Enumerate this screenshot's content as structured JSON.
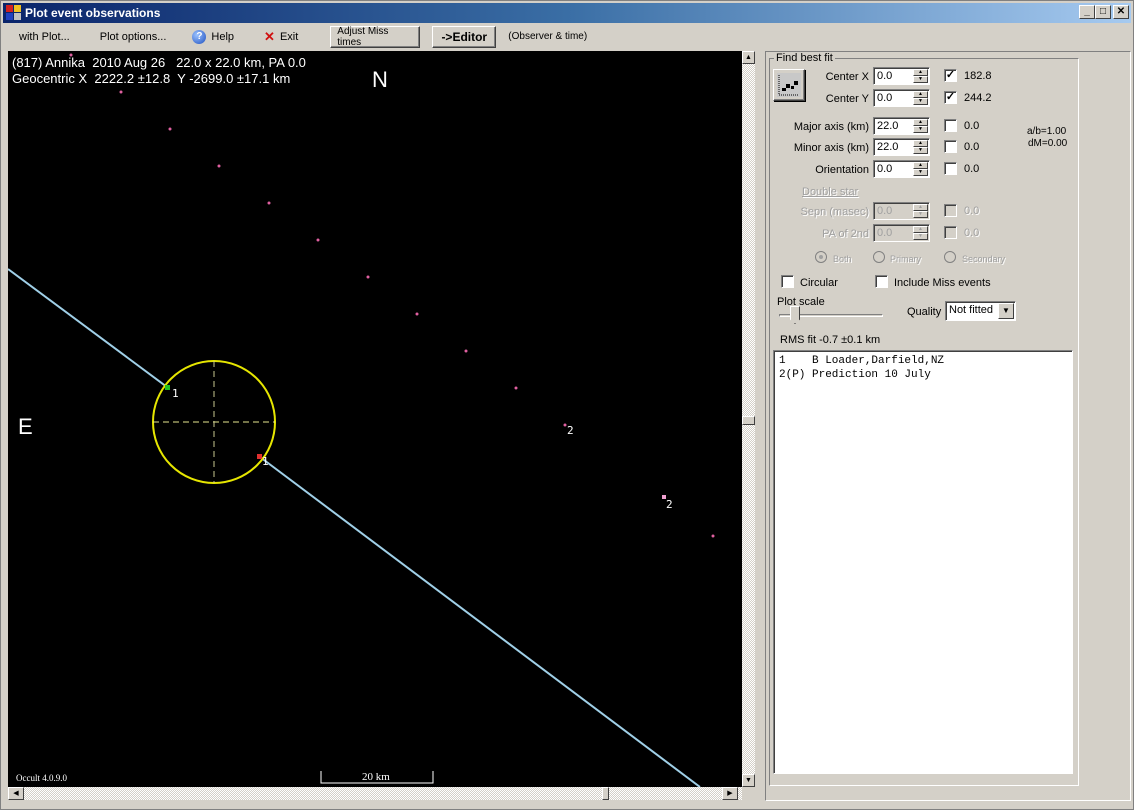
{
  "window": {
    "title": "Plot event observations",
    "controls": {
      "minimize": "_",
      "maximize": "□",
      "close": "✕"
    }
  },
  "menu": {
    "with_plot": "with Plot...",
    "plot_options": "Plot options...",
    "help": "Help",
    "exit": "Exit",
    "adjust_miss_times": "Adjust Miss times",
    "editor": "->Editor",
    "observer_time": "(Observer & time)"
  },
  "plot": {
    "header_line1": "(817) Annika  2010 Aug 26   22.0 x 22.0 km, PA 0.0",
    "header_line2": "Geocentric X  2222.2 ±12.8  Y -2699.0 ±17.1 km",
    "north_label": "N",
    "east_label": "E",
    "version": "Occult 4.0.9.0",
    "scale_bar_label": "20 km",
    "colors": {
      "background": "#000000",
      "ellipse": "#e6e600",
      "chord": "#a0d0e8",
      "disappear": "#20c020",
      "reappear": "#e03030",
      "prediction": "#e060a0"
    },
    "chord_labels": [
      "1",
      "1",
      "2",
      "2"
    ]
  },
  "fit_panel": {
    "group_label": "Find best fit",
    "center_x": {
      "label": "Center X",
      "value": "0.0",
      "checked": true,
      "result": "182.8"
    },
    "center_y": {
      "label": "Center Y",
      "value": "0.0",
      "checked": true,
      "result": "244.2"
    },
    "major_axis": {
      "label": "Major axis (km)",
      "value": "22.0",
      "checked": false,
      "result": "0.0"
    },
    "minor_axis": {
      "label": "Minor axis (km)",
      "value": "22.0",
      "checked": false,
      "result": "0.0"
    },
    "orientation": {
      "label": "Orientation",
      "value": "0.0",
      "checked": false,
      "result": "0.0"
    },
    "ratio_ab": "a/b=1.00",
    "dm": "dM=0.00",
    "double_star_label": "Double star",
    "sepn": {
      "label": "Sepn (masec)",
      "value": "0.0",
      "checked": false,
      "result": "0.0"
    },
    "pa_2nd": {
      "label": "PA of 2nd",
      "value": "0.0",
      "checked": false,
      "result": "0.0"
    },
    "radio_both": "Both",
    "radio_primary": "Primary",
    "radio_secondary": "Secondary",
    "circular_label": "Circular",
    "include_miss_label": "Include Miss events",
    "plot_scale_label": "Plot scale",
    "quality_label": "Quality",
    "quality_value": "Not fitted",
    "rms_fit": "RMS fit -0.7 ±0.1 km"
  },
  "observers": [
    "1    B Loader,Darfield,NZ",
    "2(P) Prediction 10 July"
  ]
}
